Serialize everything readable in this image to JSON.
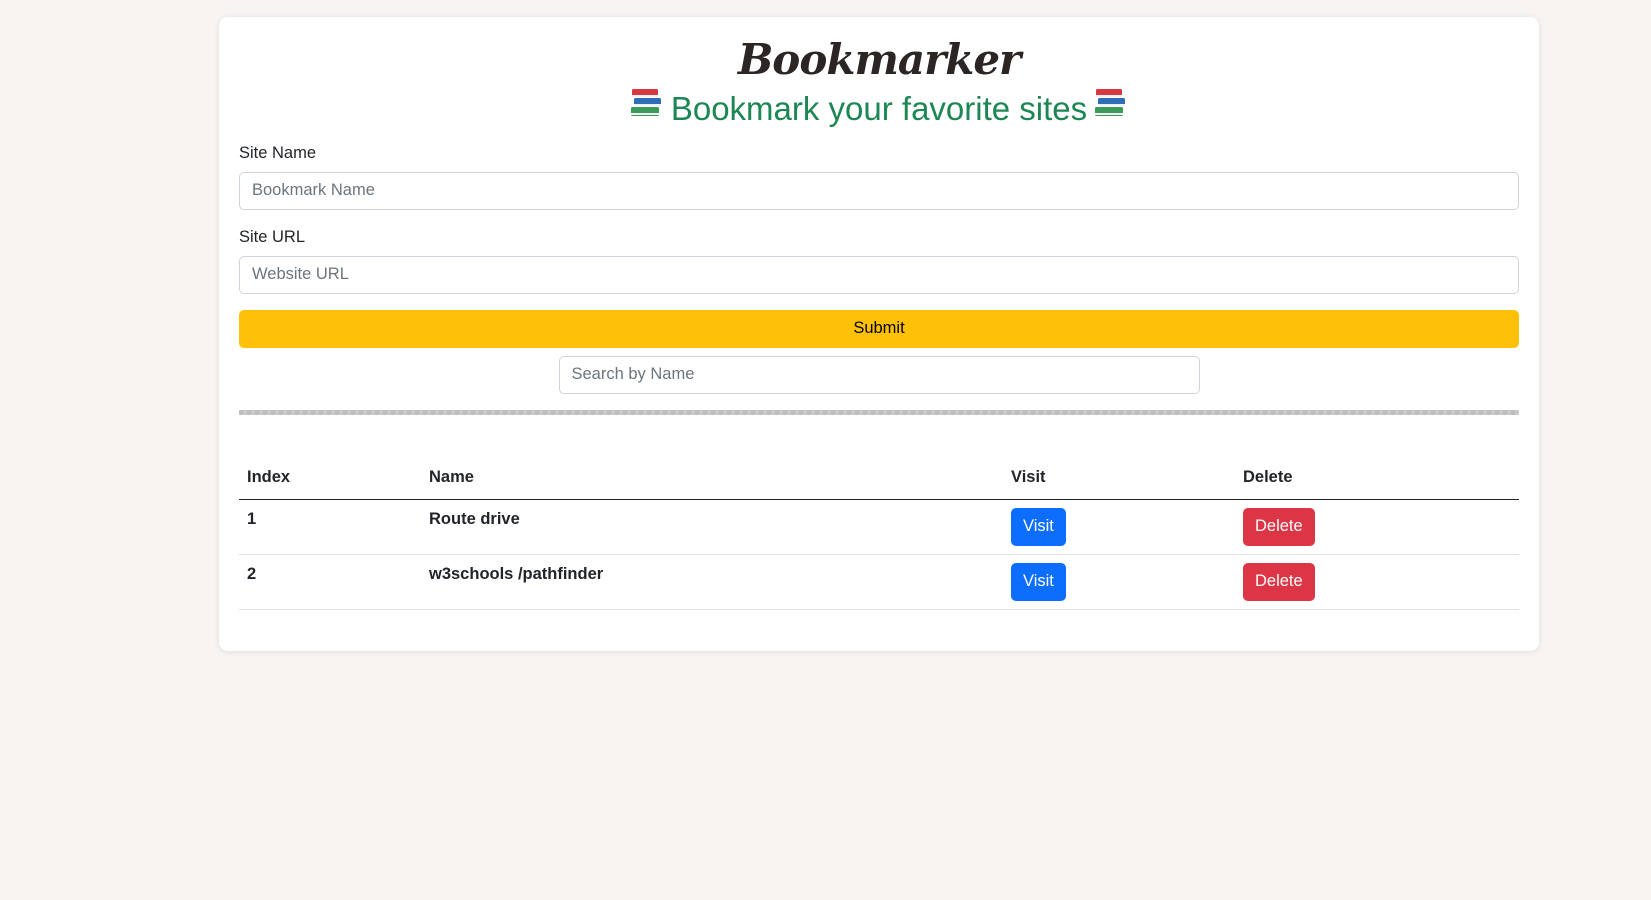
{
  "header": {
    "app_title": "Bookmarker",
    "subtitle": "Bookmark your favorite sites",
    "subtitle_icon": "books-icon"
  },
  "form": {
    "site_name_label": "Site Name",
    "site_name_placeholder": "Bookmark Name",
    "site_name_value": "",
    "site_url_label": "Site URL",
    "site_url_placeholder": "Website URL",
    "site_url_value": "",
    "submit_label": "Submit"
  },
  "search": {
    "placeholder": "Search by Name",
    "value": ""
  },
  "table": {
    "headers": [
      "Index",
      "Name",
      "Visit",
      "Delete"
    ],
    "rows": [
      {
        "index": "1",
        "name": "Route drive",
        "visit_label": "Visit",
        "delete_label": "Delete"
      },
      {
        "index": "2",
        "name": "w3schools /pathfinder",
        "visit_label": "Visit",
        "delete_label": "Delete"
      }
    ]
  },
  "colors": {
    "background": "#f7f4f2",
    "subtitle": "#1d8754",
    "submit": "#ffc107",
    "visit": "#0d6efd",
    "delete": "#dc3545"
  }
}
